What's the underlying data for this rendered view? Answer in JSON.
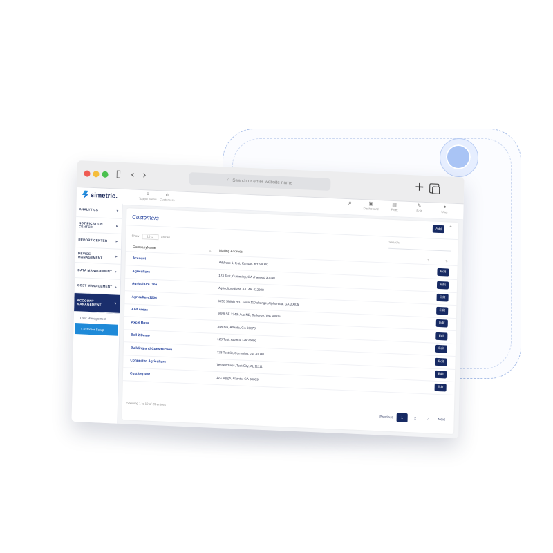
{
  "browser": {
    "address_placeholder": "Search or enter website name",
    "new_tab_symbol": "+"
  },
  "app": {
    "logo_text": "simetric.",
    "header_items": [
      {
        "icon": "hamburger-icon",
        "label": "Toggle Menu"
      },
      {
        "icon": "sitemap-icon",
        "label": "Customers"
      },
      {
        "icon": "search-icon",
        "label": ""
      },
      {
        "icon": "dashboard-icon",
        "label": "Dashboard"
      },
      {
        "icon": "building-icon",
        "label": "Fleet"
      },
      {
        "icon": "tools-icon",
        "label": "Edit"
      },
      {
        "icon": "user-icon",
        "label": "User"
      }
    ]
  },
  "sidebar": {
    "items": [
      {
        "label": "ANALYTICS",
        "arrow": "▾"
      },
      {
        "label": "NOTIFICATION CENTER",
        "arrow": "▸"
      },
      {
        "label": "REPORT CENTER",
        "arrow": "▸"
      },
      {
        "label": "DEVICE MANAGEMENT",
        "arrow": "▸"
      },
      {
        "label": "DATA MANAGEMENT",
        "arrow": "▸"
      },
      {
        "label": "COST MANAGEMENT",
        "arrow": "▸"
      },
      {
        "label": "ACCOUNT MANAGEMENT",
        "arrow": "▾"
      }
    ],
    "subitems": [
      {
        "label": "User Management"
      },
      {
        "label": "Customer Setup"
      }
    ]
  },
  "customers": {
    "title": "Customers",
    "add_label": "Add",
    "show_label": "Show",
    "show_value": "10",
    "entries_label": "entries",
    "search_label": "Search:",
    "col_company": "CompanyName",
    "col_address": "Mailing Address",
    "edit_label": "Edit",
    "rows": [
      {
        "company": "Account",
        "address": "Address 1, test, Kansas, KY 98000"
      },
      {
        "company": "Agriculture",
        "address": "123 Test, Cumming, GA changed 30040"
      },
      {
        "company": "Agriculture One",
        "address": "Agriculture East, AK, AK 412308"
      },
      {
        "company": "Agriculture1206",
        "address": "6250 Shiloh Rd., Suite 110 change, Alpharetta, GA 30005"
      },
      {
        "company": "And Areas",
        "address": "9988 SE 224th Ave NE, Bellevue, WA 98006"
      },
      {
        "company": "Axcel Rosa",
        "address": "345 Bla, Atlanta, GA 30073"
      },
      {
        "company": "Bell 2 Demo",
        "address": "123 Test, Atlanta, GA 30009"
      },
      {
        "company": "Building and Construction",
        "address": "123 Test St, Cumming, GA 30040"
      },
      {
        "company": "Connected Agriculture",
        "address": "Test Address, Test City, AL 11111"
      },
      {
        "company": "CustSegTest",
        "address": "123 sdjfgh, Atlanta, GA 30009"
      }
    ],
    "info": "Showing 1 to 10 of 29 entries",
    "pagination": {
      "previous": "Previous",
      "pages": [
        "1",
        "2",
        "3"
      ],
      "next": "Next",
      "current": "1"
    }
  },
  "colors": {
    "navy": "#172a63",
    "accent": "#1f8ad8",
    "link": "#1f3d9a"
  }
}
